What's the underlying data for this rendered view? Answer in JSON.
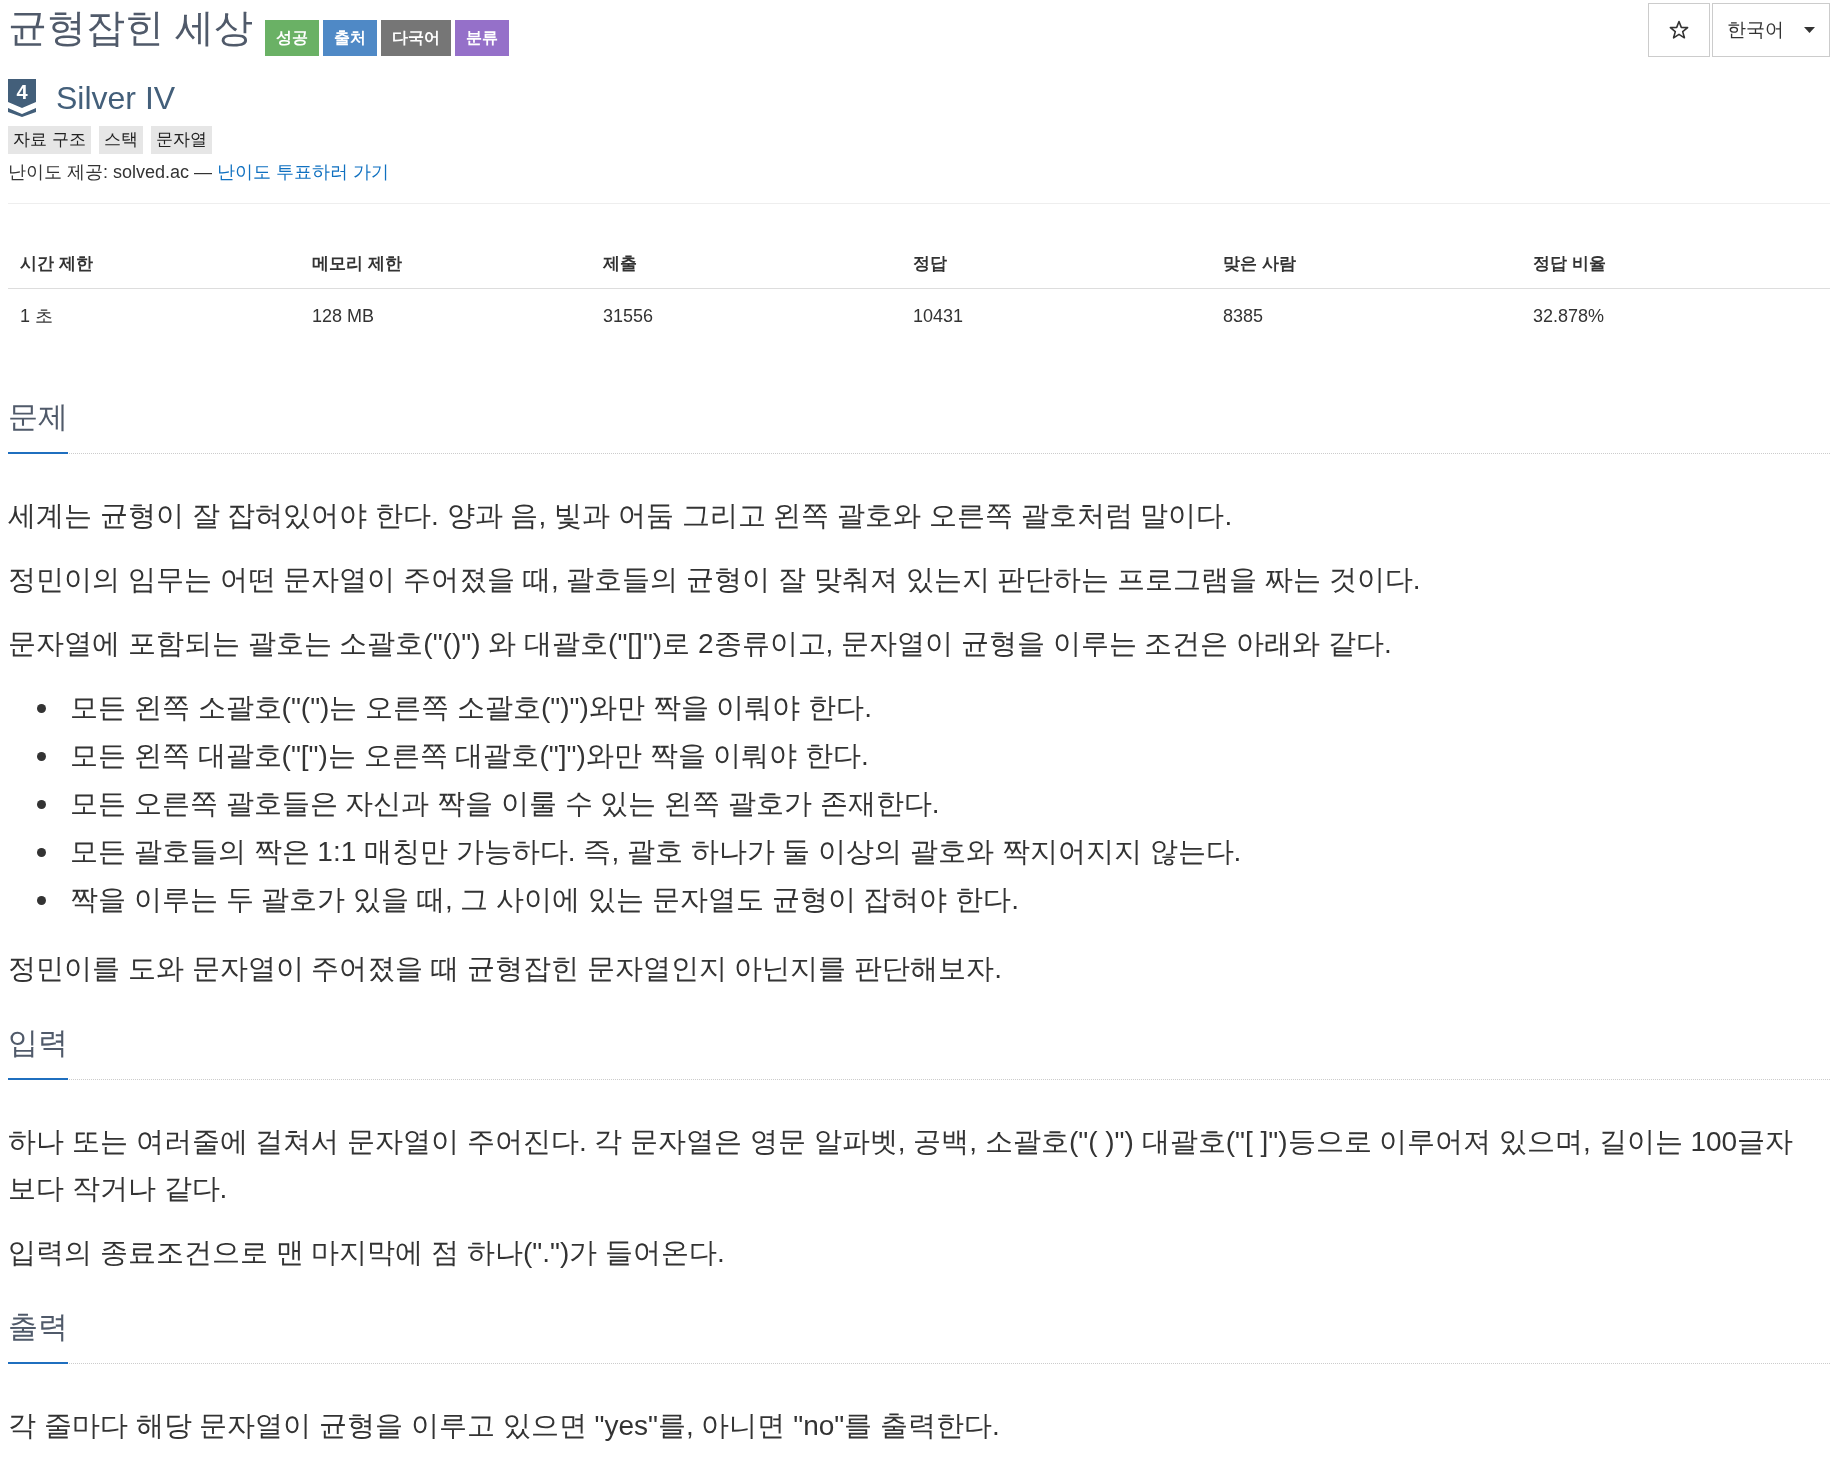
{
  "title": "균형잡힌 세상",
  "badges": [
    {
      "label": "성공",
      "color": "#6ab165"
    },
    {
      "label": "출처",
      "color": "#4f89c6"
    },
    {
      "label": "다국어",
      "color": "#767676"
    },
    {
      "label": "분류",
      "color": "#9570c9"
    }
  ],
  "toolbar": {
    "language": "한국어"
  },
  "tier": {
    "number": "4",
    "name": "Silver IV"
  },
  "tags": [
    "자료 구조",
    "스택",
    "문자열"
  ],
  "difficulty_note": {
    "text": "난이도 제공: solved.ac —",
    "link": "난이도 투표하러 가기"
  },
  "stats_table": {
    "columns": [
      "시간 제한",
      "메모리 제한",
      "제출",
      "정답",
      "맞은 사람",
      "정답 비율"
    ],
    "rows": [
      [
        "1 초",
        "128 MB",
        "31556",
        "10431",
        "8385",
        "32.878%"
      ]
    ]
  },
  "sections": [
    {
      "heading": "문제",
      "content": [
        {
          "kind": "paragraph",
          "text": "세계는 균형이 잘 잡혀있어야 한다. 양과 음, 빛과 어둠 그리고 왼쪽 괄호와 오른쪽 괄호처럼 말이다."
        },
        {
          "kind": "paragraph",
          "text": "정민이의 임무는 어떤 문자열이 주어졌을 때, 괄호들의 균형이 잘 맞춰져 있는지 판단하는 프로그램을 짜는 것이다."
        },
        {
          "kind": "paragraph",
          "text": "문자열에 포함되는 괄호는 소괄호(\"()\") 와 대괄호(\"[]\")로 2종류이고, 문자열이 균형을 이루는 조건은 아래와 같다."
        },
        {
          "kind": "bullet_list",
          "items": [
            "모든 왼쪽 소괄호(\"(\")는 오른쪽 소괄호(\")\")와만 짝을 이뤄야 한다.",
            "모든 왼쪽 대괄호(\"[\")는 오른쪽 대괄호(\"]\")와만 짝을 이뤄야 한다.",
            "모든 오른쪽 괄호들은 자신과 짝을 이룰 수 있는 왼쪽 괄호가 존재한다.",
            "모든 괄호들의 짝은 1:1 매칭만 가능하다. 즉, 괄호 하나가 둘 이상의 괄호와 짝지어지지 않는다.",
            "짝을 이루는 두 괄호가 있을 때, 그 사이에 있는 문자열도 균형이 잡혀야 한다."
          ]
        },
        {
          "kind": "paragraph",
          "text": "정민이를 도와 문자열이 주어졌을 때 균형잡힌 문자열인지 아닌지를 판단해보자."
        }
      ]
    },
    {
      "heading": "입력",
      "content": [
        {
          "kind": "paragraph",
          "text": "하나 또는 여러줄에 걸쳐서 문자열이 주어진다. 각 문자열은 영문 알파벳, 공백, 소괄호(\"( )\") 대괄호(\"[ ]\")등으로 이루어져 있으며, 길이는 100글자보다 작거나 같다."
        },
        {
          "kind": "paragraph",
          "text": "입력의 종료조건으로 맨 마지막에 점 하나(\".\")가 들어온다."
        }
      ]
    },
    {
      "heading": "출력",
      "content": [
        {
          "kind": "paragraph",
          "text": "각 줄마다 해당 문자열이 균형을 이루고 있으면 \"yes\"를, 아니면 \"no\"를 출력한다."
        }
      ]
    }
  ]
}
